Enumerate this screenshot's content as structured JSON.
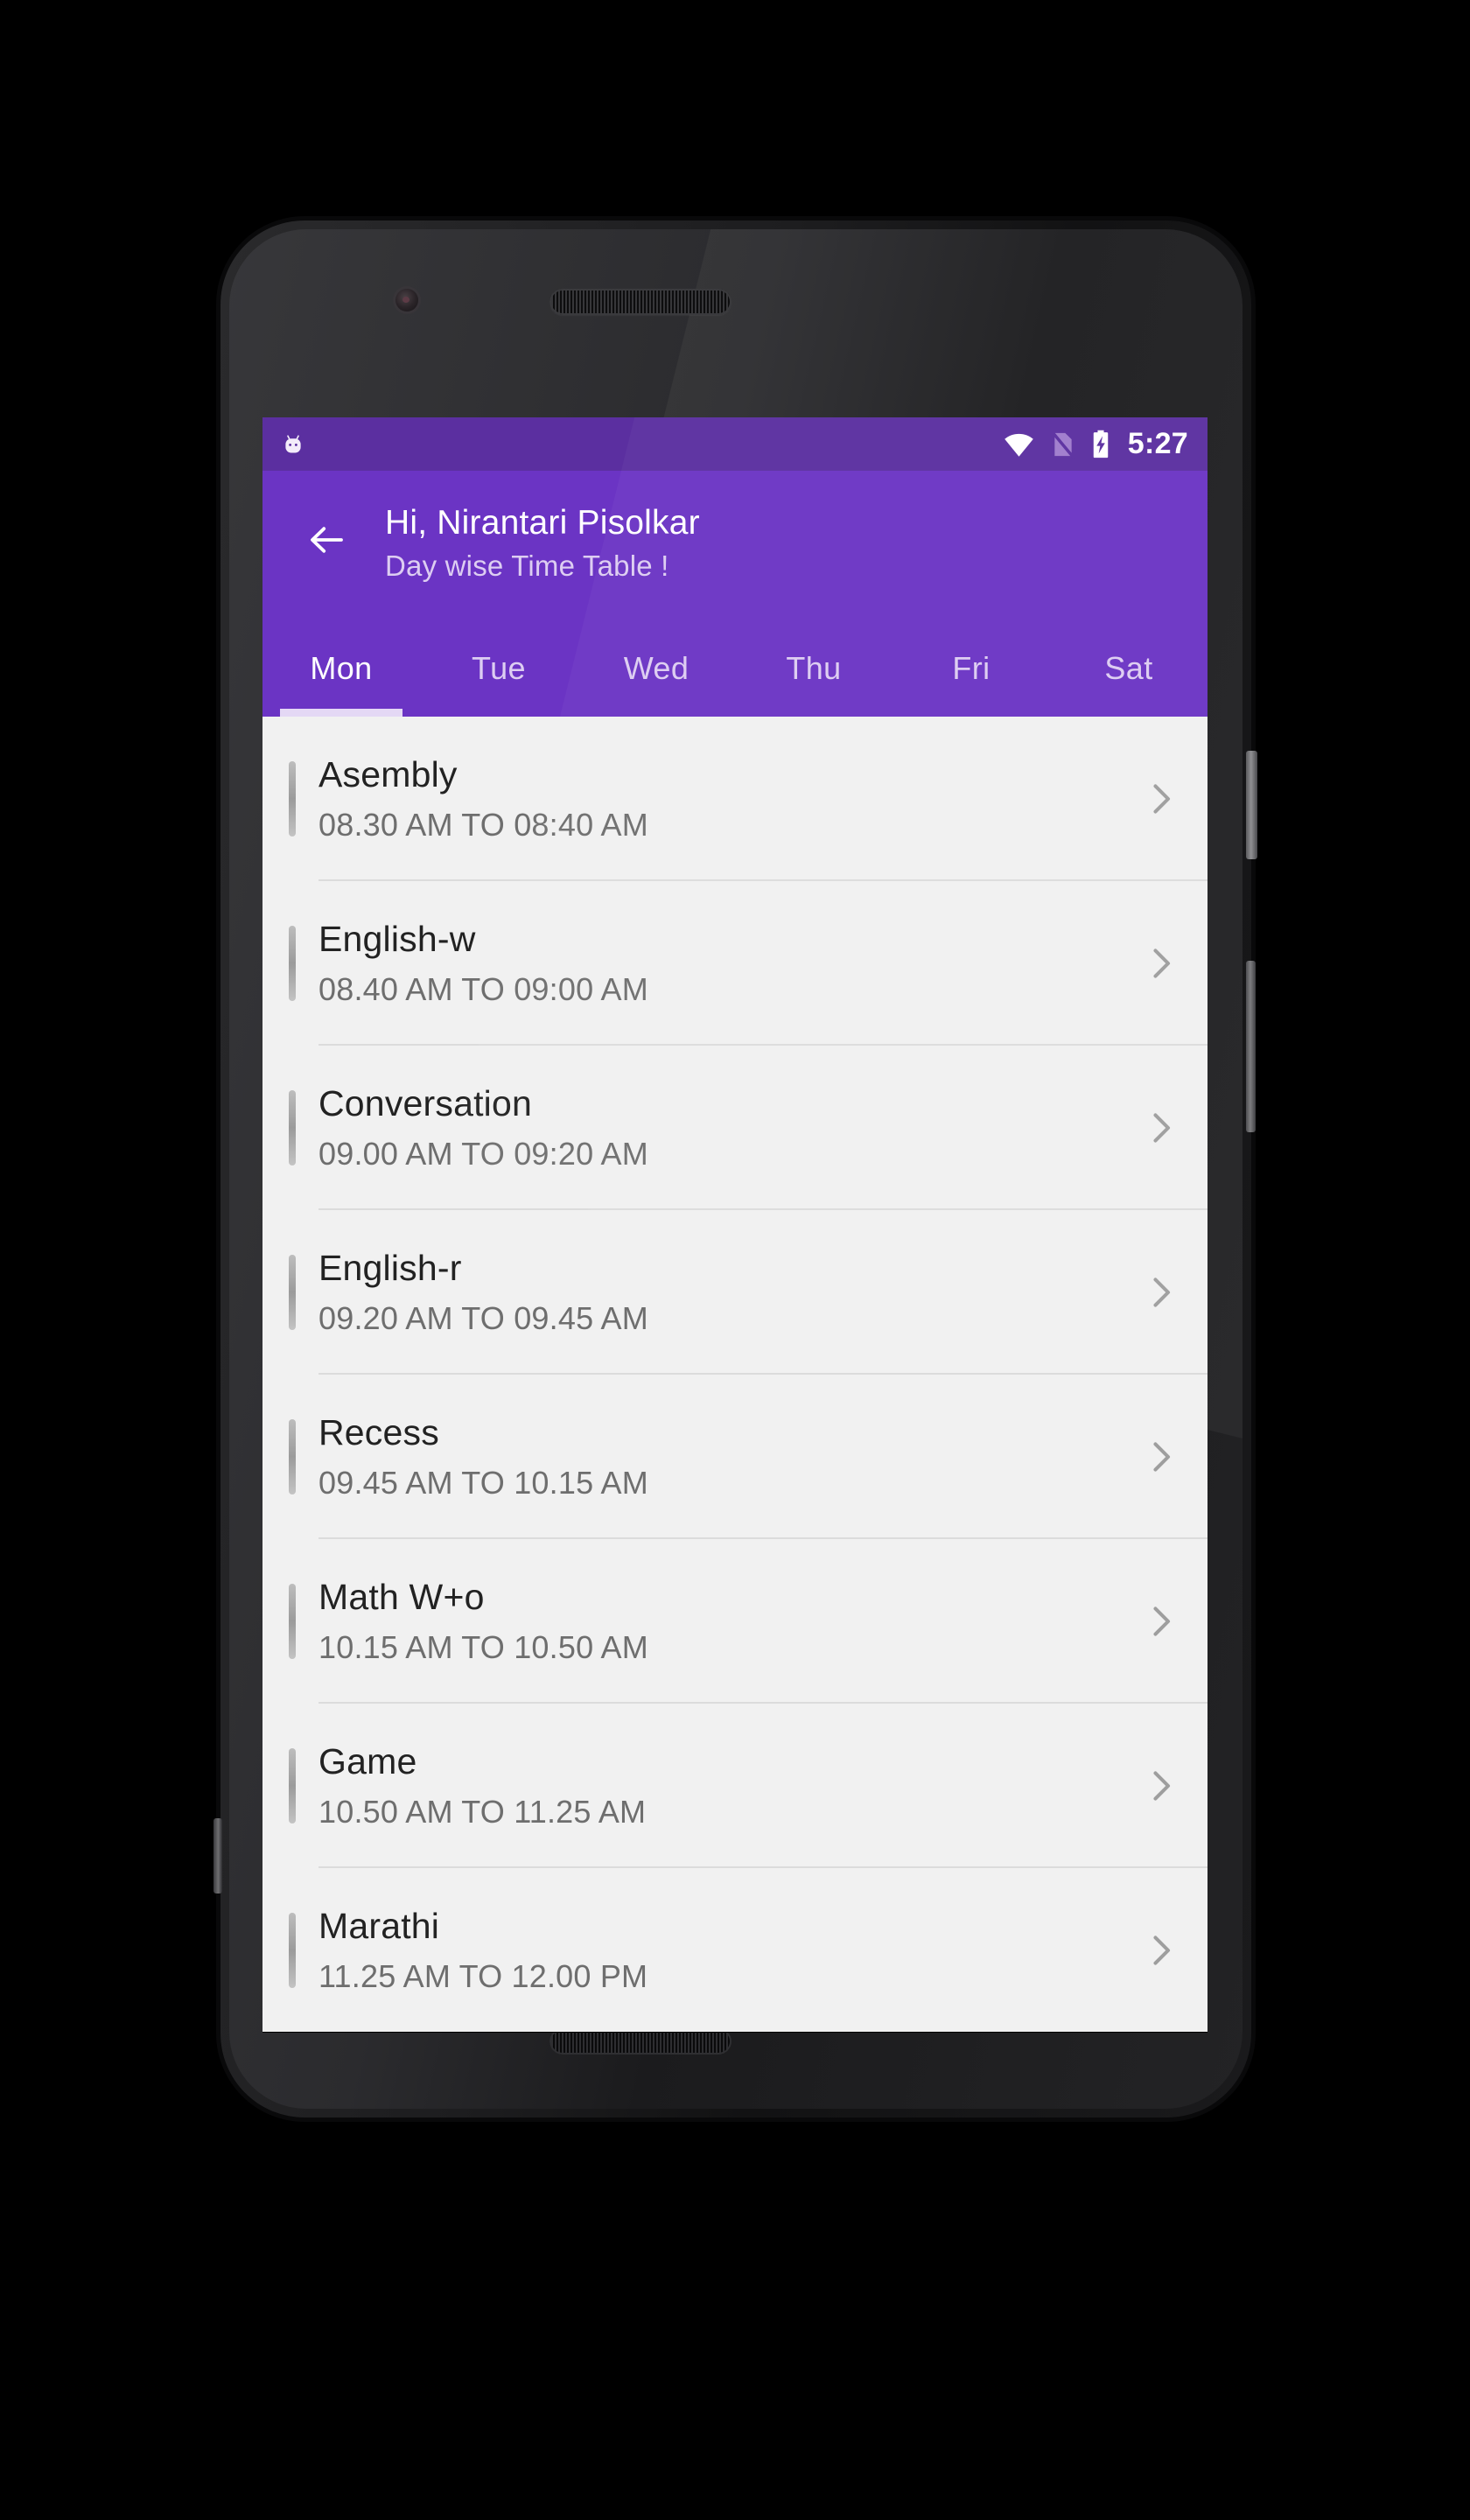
{
  "device": {
    "frame": "android-phone-nexus",
    "body_color": "#1d1d1f"
  },
  "status_bar": {
    "background": "#5b2fa0",
    "left_icons": [
      "android-bot-icon"
    ],
    "right_icons": [
      "wifi-icon",
      "no-sim-icon",
      "battery-charging-icon"
    ],
    "clock": "5:27"
  },
  "app_bar": {
    "background": "#6b34c4",
    "back_icon": "arrow-left-icon",
    "title": "Hi, Nirantari Pisolkar",
    "subtitle": "Day wise Time Table !",
    "title_color": "#ffffff",
    "subtitle_color": "#ddcdf2"
  },
  "tabs": {
    "active_index": 0,
    "indicator_color": "#e4d8f5",
    "items": [
      {
        "label": "Mon"
      },
      {
        "label": "Tue"
      },
      {
        "label": "Wed"
      },
      {
        "label": "Thu"
      },
      {
        "label": "Fri"
      },
      {
        "label": "Sat"
      }
    ]
  },
  "timetable": {
    "accent_color": "#9b9b9b",
    "chevron_icon": "chevron-right-icon",
    "rows": [
      {
        "subject": "Asembly",
        "time": "08.30 AM TO 08:40 AM"
      },
      {
        "subject": "English-w",
        "time": "08.40 AM TO 09:00 AM"
      },
      {
        "subject": "Conversation",
        "time": "09.00 AM TO 09:20 AM"
      },
      {
        "subject": "English-r",
        "time": "09.20 AM TO 09.45 AM"
      },
      {
        "subject": "Recess",
        "time": "09.45 AM TO 10.15 AM"
      },
      {
        "subject": "Math W+o",
        "time": "10.15 AM TO 10.50 AM"
      },
      {
        "subject": "Game",
        "time": "10.50 AM TO 11.25 AM"
      },
      {
        "subject": "Marathi",
        "time": "11.25 AM TO 12.00 PM"
      }
    ]
  },
  "nav_bar": {
    "background": "#000000",
    "buttons": [
      {
        "name": "back",
        "icon": "triangle-left-icon"
      },
      {
        "name": "home",
        "icon": "circle-icon"
      },
      {
        "name": "recents",
        "icon": "square-icon"
      }
    ]
  }
}
